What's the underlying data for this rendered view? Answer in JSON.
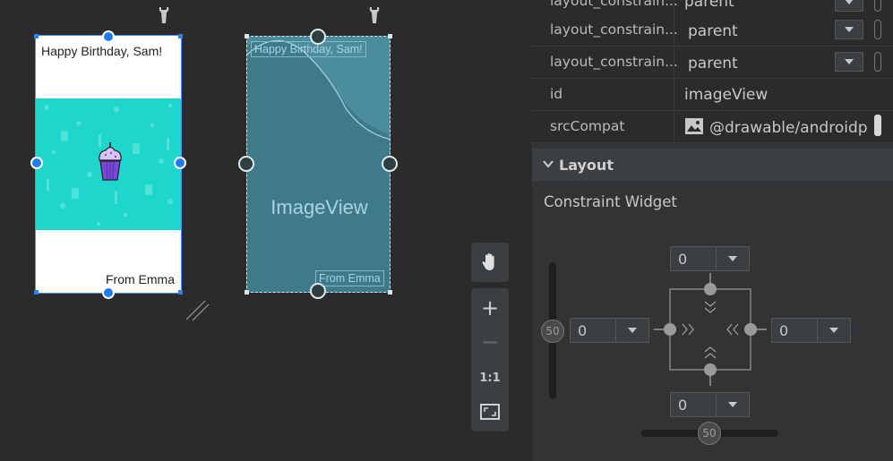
{
  "design": {
    "phone1": {
      "header_text": "Happy Birthday, Sam!",
      "footer_text": "From Emma",
      "banner_color": "#1fd6cc",
      "image_icon": "cupcake-icon"
    },
    "phone2": {
      "header_text": "Happy Birthday, Sam!",
      "footer_text": "From Emma",
      "center_label": "ImageView"
    },
    "wrench_icon": "wrench-icon"
  },
  "toolbar": {
    "pan": "hand-icon",
    "zoom_in": "+",
    "zoom_out": "−",
    "actual_size": "1:1",
    "fit": "fit-screen-icon"
  },
  "attributes": {
    "rows": [
      {
        "name": "layout_constrain...",
        "value": "parent"
      },
      {
        "name": "layout_constrain...",
        "value": "parent"
      },
      {
        "name": "layout_constrain...",
        "value": "parent"
      },
      {
        "name": "id",
        "value": "imageView"
      },
      {
        "name": "srcCompat",
        "value": "@drawable/androidp"
      }
    ],
    "section_title": "Layout",
    "widget_title": "Constraint Widget",
    "margins": {
      "top": "0",
      "left": "0",
      "right": "0",
      "bottom": "0"
    },
    "vertical_bias": "50",
    "horizontal_bias": "50"
  }
}
